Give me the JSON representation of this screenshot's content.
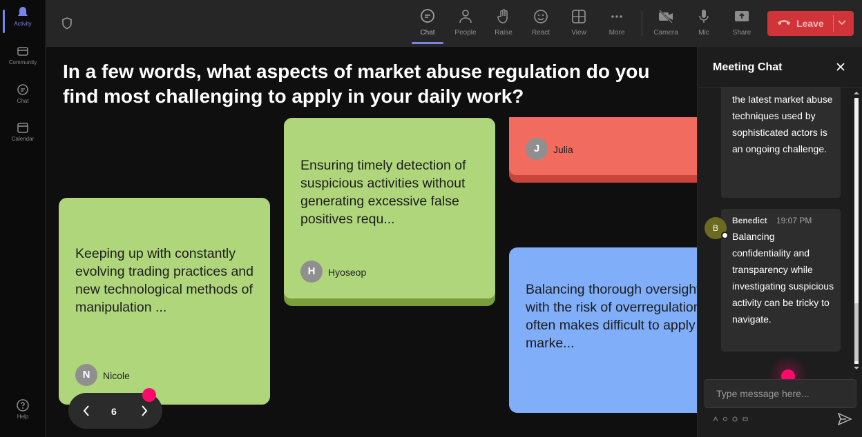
{
  "rail": {
    "items": [
      {
        "label": "Activity",
        "icon": "bell-icon"
      },
      {
        "label": "Community",
        "icon": "community-icon"
      },
      {
        "label": "Chat",
        "icon": "chat-icon"
      },
      {
        "label": "Calendar",
        "icon": "calendar-icon"
      },
      {
        "label": "Help",
        "icon": "help-icon"
      }
    ]
  },
  "toolbar": {
    "chat": "Chat",
    "people": "People",
    "raise": "Raise",
    "react": "React",
    "view": "View",
    "more": "More",
    "camera": "Camera",
    "mic": "Mic",
    "share": "Share",
    "leave": "Leave"
  },
  "stage": {
    "question": "In a few words, what aspects of market abuse regulation do you find most challenging to apply in your daily work?",
    "cards": [
      {
        "text": "Keeping up with constantly evolving trading practices and new technological methods of manipulation ...",
        "initial": "N",
        "author": "Nicole",
        "color": "#b0d67c"
      },
      {
        "text": "Ensuring timely detection of suspicious activities without generating excessive false positives requ...",
        "initial": "H",
        "author": "Hyoseop",
        "color": "#b0d67c"
      },
      {
        "text": "",
        "initial": "J",
        "author": "Julia",
        "color": "#f26b5f"
      },
      {
        "text": "Balancing thorough oversight with the risk of overregulation often makes difficult to apply marke...",
        "initial": "",
        "author": "",
        "color": "#80aef9"
      }
    ],
    "page": "6"
  },
  "chat": {
    "title": "Meeting Chat",
    "messages": [
      {
        "author": "",
        "time": "",
        "text": "the latest market abuse techniques used by sophisticated actors is an ongoing challenge."
      },
      {
        "author": "Benedict",
        "time": "19:07 PM",
        "initial": "B",
        "text": "Balancing confidentiality and transparency while investigating suspicious activity can be tricky to navigate."
      }
    ],
    "placeholder": "Type message here..."
  },
  "colors": {
    "accent": "#7b83eb",
    "leave": "#d13438",
    "cursor_dot": "#ff0a6c"
  }
}
